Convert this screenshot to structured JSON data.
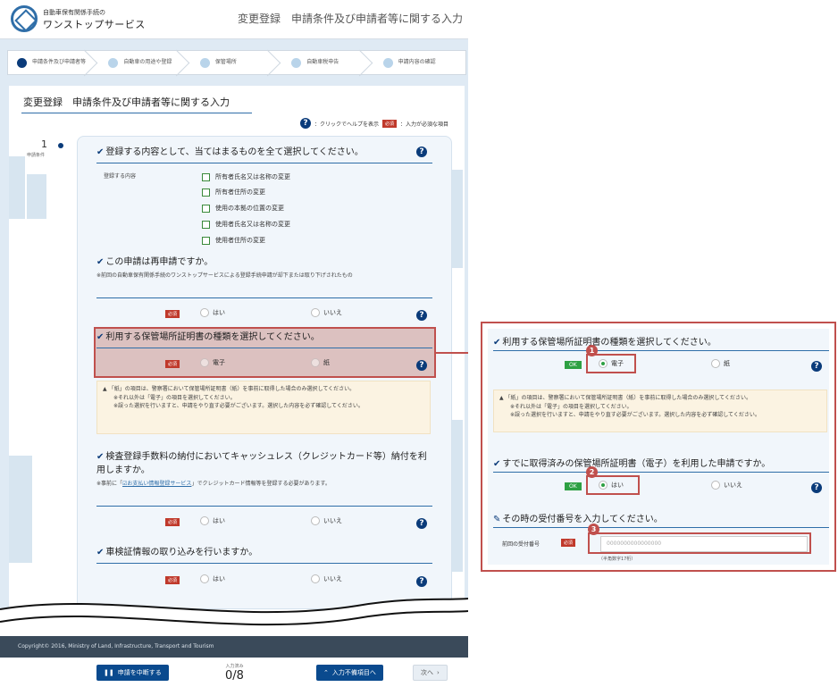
{
  "header": {
    "logo_line1": "自動車保有関係手続の",
    "logo_line2": "ワンストップサービス",
    "title": "変更登録　申請条件及び申請者等に関する入力"
  },
  "steps": [
    {
      "label": "申請条件及び申請者等"
    },
    {
      "label": "自動車の用途や登録"
    },
    {
      "label": "保管場所"
    },
    {
      "label": "自動車税申告"
    },
    {
      "label": "申請内容の確認"
    }
  ],
  "panel": {
    "title": "変更登録　申請条件及び申請者等に関する入力",
    "legend_help": "：クリックでヘルプを表示",
    "legend_required": "：入力が必須な項目",
    "required_badge": "必須"
  },
  "sidebar": {
    "number": "1",
    "caption": "申請条件"
  },
  "q1": {
    "title": "登録する内容として、当てはまるものを全て選択してください。",
    "field_label": "登録する内容",
    "options": [
      "所有者氏名又は名称の変更",
      "所有者住所の変更",
      "使用の本拠の位置の変更",
      "使用者氏名又は名称の変更",
      "使用者住所の変更"
    ]
  },
  "q2": {
    "title": "この申請は再申請ですか。",
    "note": "※前回の自動車保有関係手続のワンストップサービスによる登録手続申請が却下または取り下げされたもの",
    "yes": "はい",
    "no": "いいえ"
  },
  "q3": {
    "title": "利用する保管場所証明書の種類を選択してください。",
    "opt1": "電子",
    "opt2": "紙"
  },
  "warning": {
    "line1": "「紙」の項目は、警察署において保管場所証明書（紙）を事前に取得した場合のみ選択してください。",
    "line2": "※それ以外は「電子」の項目を選択してください。",
    "line3": "※誤った選択を行いますと、申請をやり直す必要がございます。選択した内容を必ず確認してください。"
  },
  "q4": {
    "title": "検査登録手数料の納付においてキャッシュレス（クレジットカード等）納付を利用しますか。",
    "note_prefix": "※事前に「",
    "note_link": "お支払い情報登録サービス",
    "note_suffix": "」でクレジットカード情報等を登録する必要があります。",
    "yes": "はい",
    "no": "いいえ"
  },
  "q5": {
    "title": "車検証情報の取り込みを行いますか。",
    "yes": "はい",
    "no": "いいえ"
  },
  "footer": {
    "copyright": "Copyright© 2016, Ministry of Land, Infrastructure, Transport and Tourism"
  },
  "bottom_bar": {
    "suspend": "申請を中断する",
    "progress_caption": "入力済み",
    "progress_value": "0/8",
    "incomplete": "入力不備項目へ",
    "next": "次へ"
  },
  "zoom": {
    "q3_title": "利用する保管場所証明書の種類を選択してください。",
    "ok_badge": "OK",
    "opt1": "電子",
    "opt2": "紙",
    "q6_title": "すでに取得済みの保管場所証明書（電子）を利用した申請ですか。",
    "yes": "はい",
    "no": "いいえ",
    "q7_title": "その時の受付番号を入力してください。",
    "field_label": "前回の受付番号",
    "input_value": "0000000000000000",
    "hint": "（半角数字17桁）",
    "markers": [
      "1",
      "2",
      "3"
    ]
  },
  "icons": [
    "help-icon",
    "check-icon",
    "edit-icon",
    "warning-icon",
    "pause-icon",
    "up-arrow-icon",
    "chevron-right-icon",
    "external-link-icon"
  ]
}
